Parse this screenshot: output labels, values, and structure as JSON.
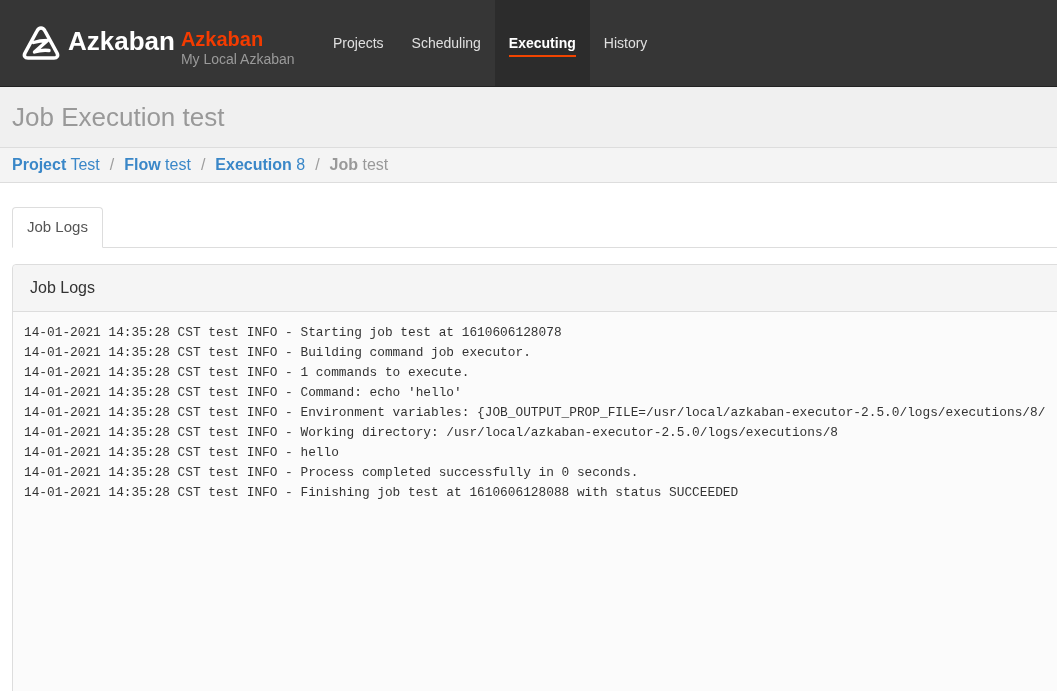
{
  "navbar": {
    "brand": {
      "name": "Azkaban",
      "instance_name": "Azkaban",
      "subtitle": "My Local Azkaban"
    },
    "items": [
      {
        "label": "Projects",
        "selected": false
      },
      {
        "label": "Scheduling",
        "selected": false
      },
      {
        "label": "Executing",
        "selected": true
      },
      {
        "label": "History",
        "selected": false
      }
    ]
  },
  "page_header": {
    "title": "Job Execution test"
  },
  "breadcrumb": {
    "separator": "/",
    "items": [
      {
        "text": "**Project** Test",
        "current": false
      },
      {
        "text": "**Flow** test",
        "current": false
      },
      {
        "text": "**Execution** 8",
        "current": false
      },
      {
        "text": "**Job** test",
        "current": true
      }
    ]
  },
  "tabs": [
    {
      "label": "Job Logs",
      "selected": true
    }
  ],
  "panel": {
    "title": "Job Logs",
    "log_lines": [
      "14-01-2021 14:35:28 CST test INFO - Starting job test at 1610606128078",
      "14-01-2021 14:35:28 CST test INFO - Building command job executor.",
      "14-01-2021 14:35:28 CST test INFO - 1 commands to execute.",
      "14-01-2021 14:35:28 CST test INFO - Command: echo 'hello'",
      "14-01-2021 14:35:28 CST test INFO - Environment variables: {JOB_OUTPUT_PROP_FILE=/usr/local/azkaban-executor-2.5.0/logs/executions/8/",
      "14-01-2021 14:35:28 CST test INFO - Working directory: /usr/local/azkaban-executor-2.5.0/logs/executions/8",
      "14-01-2021 14:35:28 CST test INFO - hello",
      "14-01-2021 14:35:28 CST test INFO - Process completed successfully in 0 seconds.",
      "14-01-2021 14:35:28 CST test INFO - Finishing job test at 1610606128088 with status SUCCEEDED"
    ]
  }
}
